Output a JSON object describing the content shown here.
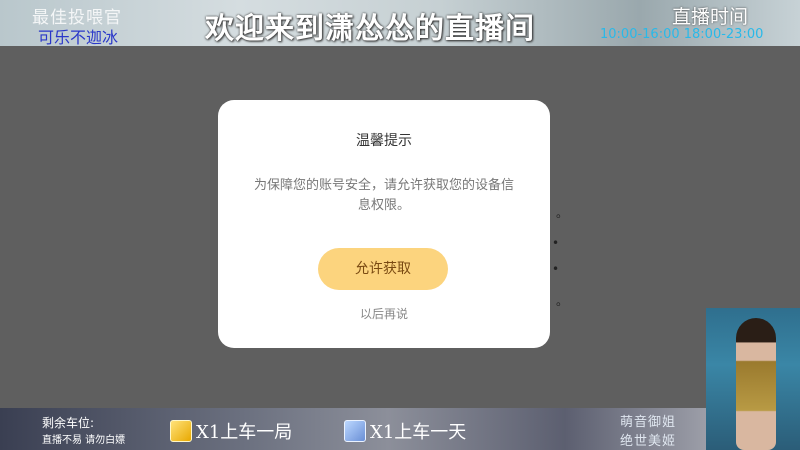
{
  "header": {
    "top_left_line1": "最佳投喂官",
    "top_left_line2": "可乐不迦冰",
    "welcome": "欢迎来到潇怂怂的直播间",
    "live_time_label": "直播时间",
    "live_time": "10:00-16:00 18:00-23:00"
  },
  "dialog": {
    "title": "温馨提示",
    "message": "为保障您的账号安全，请允许获取您的设备信息权限。",
    "allow_button": "允许获取",
    "later_link": "以后再说"
  },
  "bottom_bar": {
    "seats_label": "剩余车位:",
    "seats_note": "直播不易 请勿白嫖",
    "gift1_text": "X1上车一局",
    "gift2_text": "X1上车一天",
    "tag1": "萌音御姐",
    "tag2": "绝世美姬"
  },
  "colors": {
    "allow_button_bg": "#fcd47e",
    "live_time_color": "#29b9e9"
  }
}
